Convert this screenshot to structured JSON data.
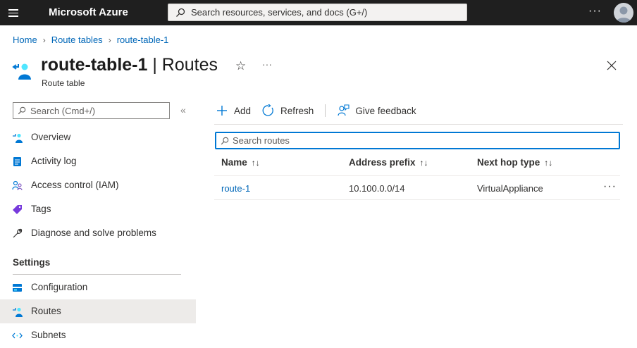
{
  "topbar": {
    "brand": "Microsoft Azure",
    "search_placeholder": "Search resources, services, and docs (G+/)",
    "more": "···",
    "bg_color": "#1f1f1f"
  },
  "breadcrumb": {
    "items": [
      "Home",
      "Route tables",
      "route-table-1"
    ],
    "separator": "›"
  },
  "header": {
    "resource_name": "route-table-1",
    "divider": " | ",
    "page": "Routes",
    "subtitle": "Route table",
    "star": "☆",
    "more": "···"
  },
  "sidebar": {
    "search_placeholder": "Search (Cmd+/)",
    "collapse": "«",
    "items": [
      {
        "label": "Overview",
        "icon": "route-table-icon"
      },
      {
        "label": "Activity log",
        "icon": "activity-log-icon"
      },
      {
        "label": "Access control (IAM)",
        "icon": "iam-icon"
      },
      {
        "label": "Tags",
        "icon": "tag-icon"
      },
      {
        "label": "Diagnose and solve problems",
        "icon": "wrench-icon"
      }
    ],
    "settings_heading": "Settings",
    "settings_items": [
      {
        "label": "Configuration",
        "icon": "configuration-icon"
      },
      {
        "label": "Routes",
        "icon": "route-table-icon",
        "selected": true
      },
      {
        "label": "Subnets",
        "icon": "subnet-icon"
      }
    ]
  },
  "toolbar": {
    "add_label": "Add",
    "refresh_label": "Refresh",
    "feedback_label": "Give feedback"
  },
  "routes": {
    "search_placeholder": "Search routes",
    "columns": [
      {
        "label": "Name",
        "sort": "↑↓"
      },
      {
        "label": "Address prefix",
        "sort": "↑↓"
      },
      {
        "label": "Next hop type",
        "sort": "↑↓"
      }
    ],
    "rows": [
      {
        "name": "route-1",
        "address_prefix": "10.100.0.0/14",
        "next_hop_type": "VirtualAppliance",
        "more": "···"
      }
    ]
  },
  "colors": {
    "accent": "#0078d4",
    "link": "#0067b8",
    "selected_bg": "#edebe9"
  }
}
